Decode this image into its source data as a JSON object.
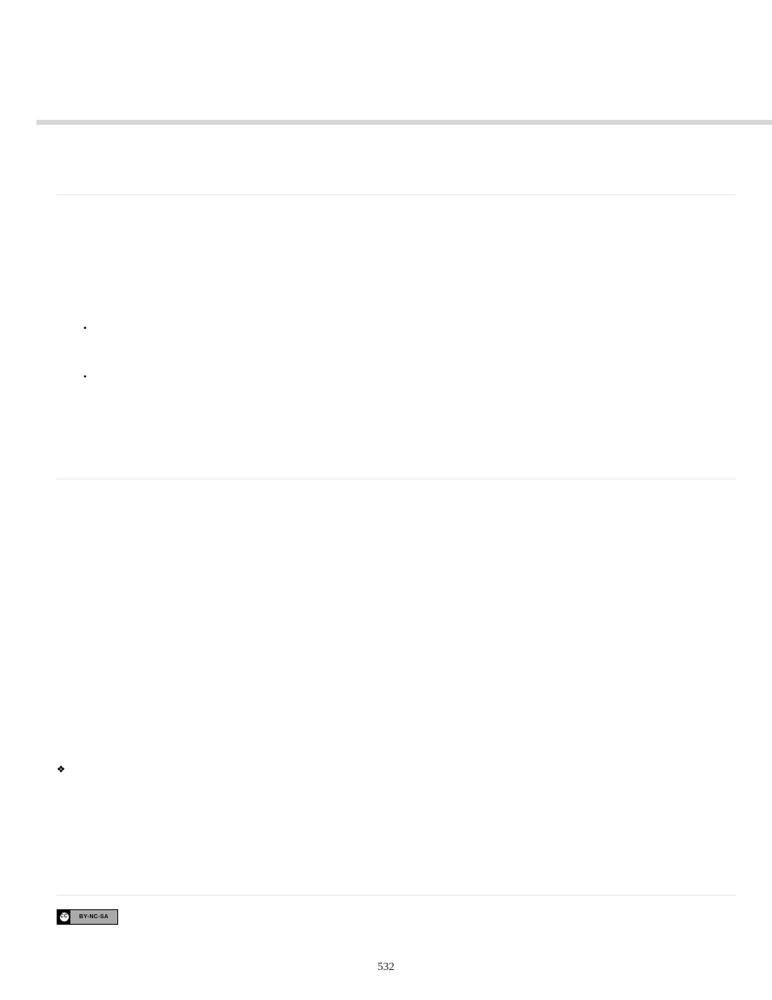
{
  "page_number": "532",
  "license": {
    "cc_label": "CC",
    "terms": "BY-NC-SA"
  },
  "sections": {
    "intro": "",
    "bullets": [
      "",
      ""
    ],
    "body": "",
    "diamond_item": ""
  }
}
